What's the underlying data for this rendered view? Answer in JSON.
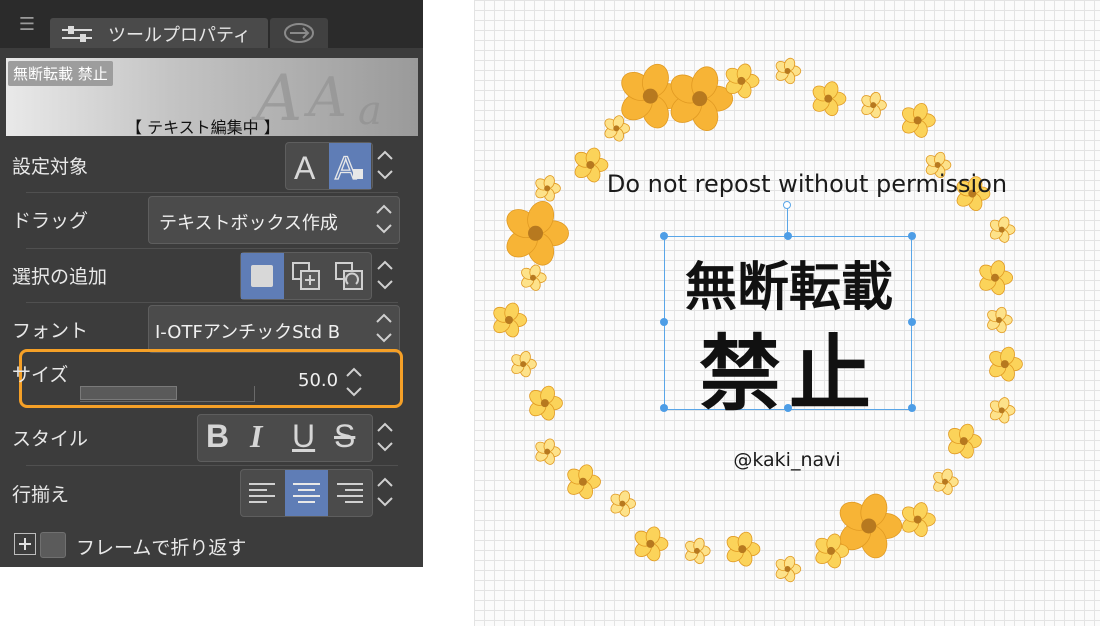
{
  "panel": {
    "menu_glyph": "☰",
    "tab_title": "ツールプロパティ",
    "preview": {
      "badge": "無断転載 禁止",
      "caption": "【 テキスト編集中 】"
    },
    "rows": {
      "target": {
        "label": "設定対象"
      },
      "drag": {
        "label": "ドラッグ",
        "value": "テキストボックス作成"
      },
      "selection": {
        "label": "選択の追加"
      },
      "font": {
        "label": "フォント",
        "value": "I-OTFアンチックStd B"
      },
      "size": {
        "label": "サイズ",
        "value": "50.0",
        "level_fraction": 0.56
      },
      "style": {
        "label": "スタイル",
        "bold": "B",
        "italic": "I",
        "underline": "U",
        "strike": "S"
      },
      "align": {
        "label": "行揃え"
      },
      "wrap": {
        "label": "フレームで折り返す"
      }
    },
    "colors": {
      "panel_bg": "#3c3c3c",
      "selected": "#5f7db6",
      "highlight": "#f5a027"
    }
  },
  "canvas": {
    "top_text": "Do not repost without permission",
    "jp_line1": "無断転載",
    "jp_line2": "禁止",
    "handle_text": "@kaki_navi",
    "colors": {
      "flower": "#f6b93b",
      "selection": "#5aa6e8"
    }
  }
}
